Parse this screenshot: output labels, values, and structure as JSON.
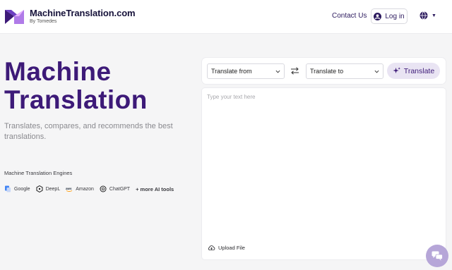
{
  "header": {
    "brand_name": "MachineTranslation.com",
    "brand_sub": "By Tomedes",
    "contact_label": "Contact Us",
    "login_label": "Log in",
    "language_icon": "globe-icon"
  },
  "hero": {
    "title_line1": "Machine",
    "title_line2": "Translation",
    "description": "Translates, compares, and recommends the best translations.",
    "engines_label": "Machine Translation Engines",
    "engines": [
      {
        "name": "Google",
        "icon": "google-icon"
      },
      {
        "name": "DeepL",
        "icon": "deepl-icon"
      },
      {
        "name": "Amazon",
        "icon": "amazon-icon"
      },
      {
        "name": "ChatGPT",
        "icon": "chatgpt-icon"
      }
    ],
    "more_tools": "+ more AI tools"
  },
  "translator": {
    "from_label": "Translate from",
    "to_label": "Translate to",
    "translate_button": "Translate",
    "input_placeholder": "Type your text here",
    "upload_label": "Upload File"
  },
  "colors": {
    "accent": "#3d1a78",
    "button_bg": "#e9e4f3",
    "chat_bubble": "#b6a6d8"
  }
}
